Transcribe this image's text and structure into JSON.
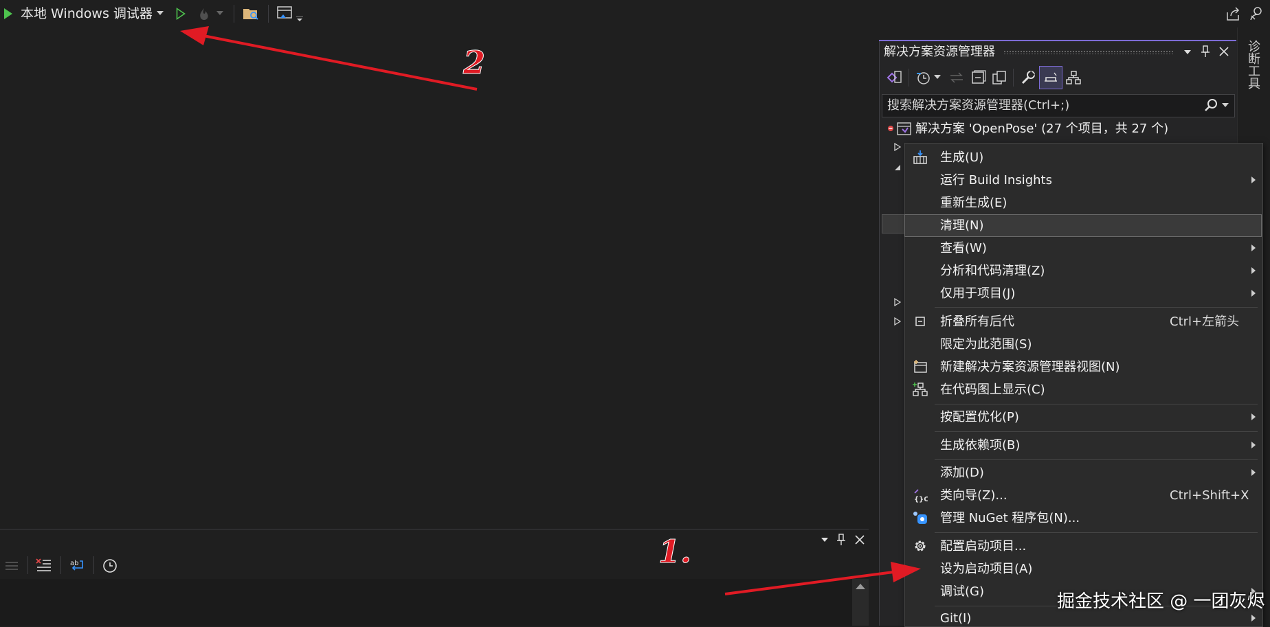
{
  "toolbar": {
    "debug_target": "本地 Windows 调试器"
  },
  "solution_explorer": {
    "title": "解决方案资源管理器",
    "search_placeholder": "搜索解决方案资源管理器(Ctrl+;)",
    "root_label": "解决方案 'OpenPose' (27 个项目，共 27 个)"
  },
  "diagnostics_rail": {
    "label": "诊断工具"
  },
  "context_menu": {
    "items": [
      {
        "label": "生成(U)",
        "icon": "build-icon"
      },
      {
        "label": "运行 Build Insights",
        "submenu": true
      },
      {
        "label": "重新生成(E)"
      },
      {
        "label": "清理(N)",
        "highlighted": true
      },
      {
        "label": "查看(W)",
        "submenu": true
      },
      {
        "label": "分析和代码清理(Z)",
        "submenu": true
      },
      {
        "label": "仅用于项目(J)",
        "submenu": true
      },
      {
        "label": "折叠所有后代",
        "shortcut": "Ctrl+左箭头",
        "icon": "collapse-all-icon"
      },
      {
        "label": "限定为此范围(S)"
      },
      {
        "label": "新建解决方案资源管理器视图(N)",
        "icon": "new-view-icon"
      },
      {
        "label": "在代码图上显示(C)",
        "icon": "code-map-icon"
      },
      {
        "label": "按配置优化(P)",
        "submenu": true
      },
      {
        "label": "生成依赖项(B)",
        "submenu": true
      },
      {
        "label": "添加(D)",
        "submenu": true
      },
      {
        "label": "类向导(Z)...",
        "shortcut": "Ctrl+Shift+X",
        "icon": "class-wizard-icon"
      },
      {
        "label": "管理 NuGet 程序包(N)...",
        "icon": "nuget-icon"
      },
      {
        "label": "配置启动项目...",
        "icon": "gear-icon"
      },
      {
        "label": "设为启动项目(A)"
      },
      {
        "label": "调试(G)",
        "submenu": true
      },
      {
        "label": "Git(I)",
        "submenu": true
      }
    ]
  },
  "annotations": {
    "callout_1": "1.",
    "callout_2": "2",
    "arrow_color": "#e01b24"
  },
  "watermark": "掘金技术社区 @ 一团灰烬"
}
